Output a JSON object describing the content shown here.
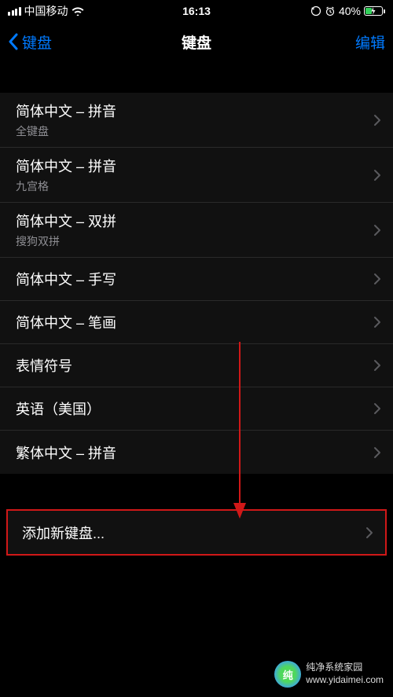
{
  "status": {
    "carrier": "中国移动",
    "time": "16:13",
    "battery_percent": "40%"
  },
  "nav": {
    "back_label": "键盘",
    "title": "键盘",
    "edit_label": "编辑"
  },
  "keyboards": [
    {
      "title": "简体中文 – 拼音",
      "subtitle": "全键盘"
    },
    {
      "title": "简体中文 – 拼音",
      "subtitle": "九宫格"
    },
    {
      "title": "简体中文 – 双拼",
      "subtitle": "搜狗双拼"
    },
    {
      "title": "简体中文 – 手写",
      "subtitle": null
    },
    {
      "title": "简体中文 – 笔画",
      "subtitle": null
    },
    {
      "title": "表情符号",
      "subtitle": null
    },
    {
      "title": "英语（美国）",
      "subtitle": null
    },
    {
      "title": "繁体中文 – 拼音",
      "subtitle": null
    }
  ],
  "add_keyboard_label": "添加新键盘...",
  "watermark": {
    "line1": "纯净系统家园",
    "line2": "www.yidaimei.com"
  }
}
